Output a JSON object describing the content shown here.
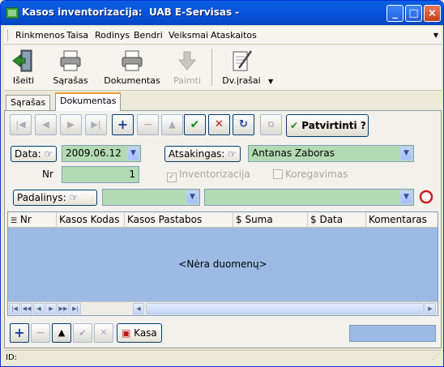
{
  "window": {
    "title": "Kasos inventorizacija:  UAB E-Servisas -",
    "buttons": [
      "_",
      "□",
      "×"
    ]
  },
  "menu": [
    "Rinkmenos",
    "Taisa",
    "Rodinys",
    "Bendri",
    "Veiksmai",
    "Ataskaitos"
  ],
  "toolbar": {
    "items": [
      {
        "label": "Išeiti",
        "icon": "exit-door-icon",
        "enabled": true
      },
      {
        "label": "Sąrašas",
        "icon": "printer-icon",
        "enabled": true
      },
      {
        "label": "Dokumentas",
        "icon": "printer-icon",
        "enabled": true
      },
      {
        "label": "Paimti",
        "icon": "down-arrow-icon",
        "enabled": false
      },
      {
        "label": "Dv.įrašai",
        "icon": "notepad-pen-icon",
        "enabled": true
      }
    ]
  },
  "tabs": [
    {
      "label": "Sąrašas",
      "active": false
    },
    {
      "label": "Dokumentas",
      "active": true
    }
  ],
  "nav": {
    "confirm_label": "Patvirtinti ?"
  },
  "form": {
    "data_label": "Data:",
    "data_value": "2009.06.12",
    "atsakingas_label": "Atsakingas:",
    "atsakingas_value": "Antanas Zaboras",
    "nr_label": "Nr",
    "nr_value": "1",
    "inventorizacija_label": "Inventorizacija",
    "inventorizacija_checked": true,
    "koregavimas_label": "Koregavimas",
    "koregavimas_checked": false,
    "padalinys_label": "Padalinys:",
    "padalinys_value": "",
    "padalinys_name_value": ""
  },
  "grid": {
    "columns": [
      "Nr",
      "Kasos Kodas",
      "Kasos Pastabos",
      "$ Suma",
      "$ Data",
      "Komentaras"
    ],
    "empty_text": "<Nėra duomenų>"
  },
  "bottom": {
    "kasa_label": "Kasa"
  },
  "status": {
    "text": "ID:"
  },
  "colors": {
    "field_green": "#b3dbb3",
    "grid_blue": "#9cbae4",
    "title_blue": "#0854dd"
  }
}
